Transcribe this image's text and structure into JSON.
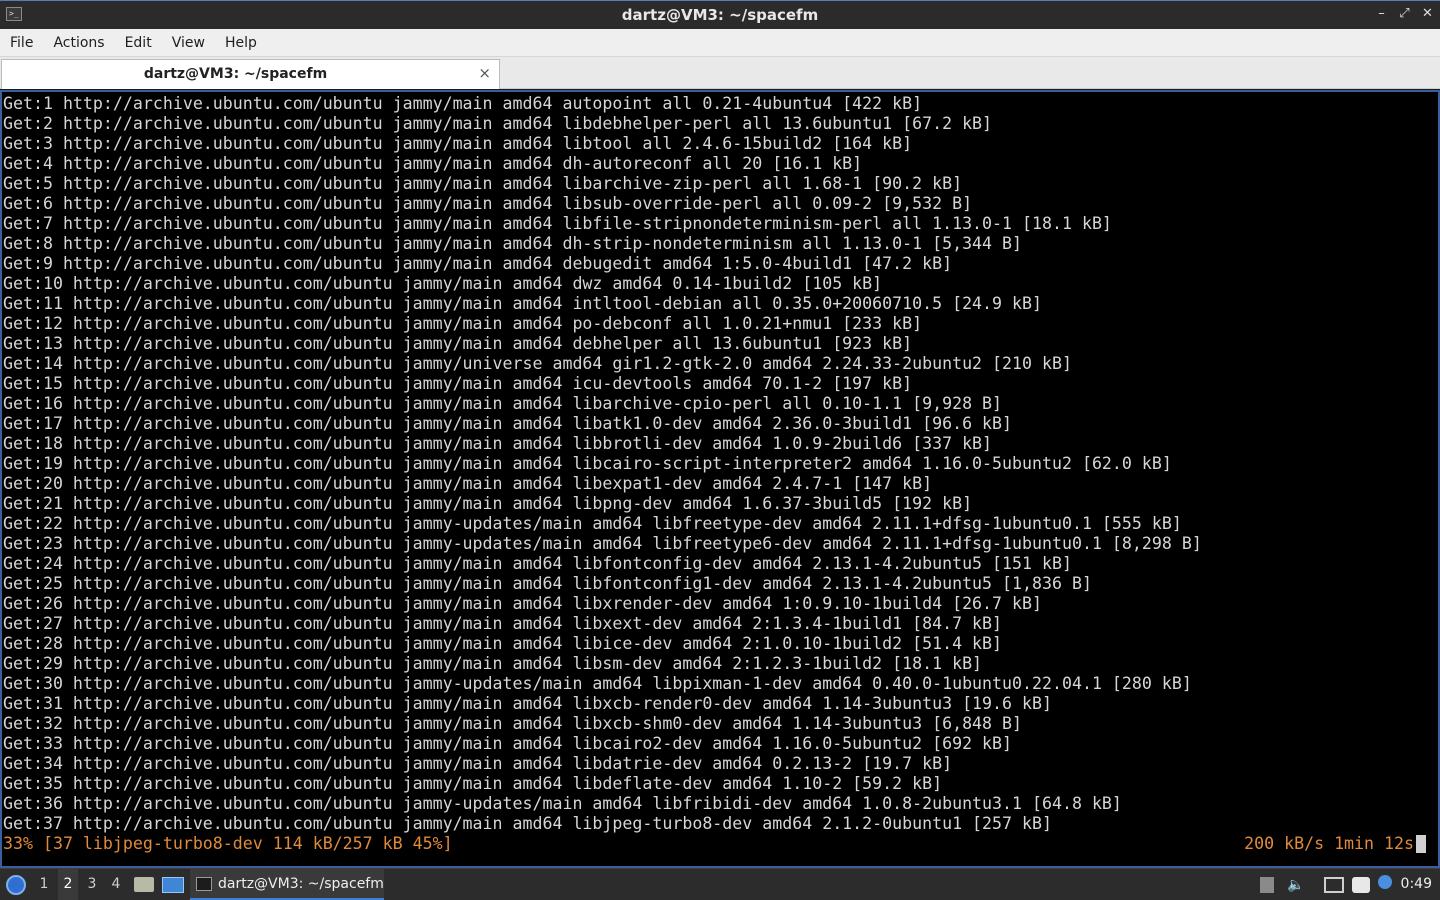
{
  "window": {
    "title": "dartz@VM3: ~/spacefm",
    "icon": "terminal-icon",
    "buttons": [
      "minimize",
      "maximize",
      "close"
    ]
  },
  "menu": [
    "File",
    "Actions",
    "Edit",
    "View",
    "Help"
  ],
  "tab": {
    "title": "dartz@VM3: ~/spacefm",
    "close_icon": "×"
  },
  "terminal": {
    "lines": [
      "Get:1 http://archive.ubuntu.com/ubuntu jammy/main amd64 autopoint all 0.21-4ubuntu4 [422 kB]",
      "Get:2 http://archive.ubuntu.com/ubuntu jammy/main amd64 libdebhelper-perl all 13.6ubuntu1 [67.2 kB]",
      "Get:3 http://archive.ubuntu.com/ubuntu jammy/main amd64 libtool all 2.4.6-15build2 [164 kB]",
      "Get:4 http://archive.ubuntu.com/ubuntu jammy/main amd64 dh-autoreconf all 20 [16.1 kB]",
      "Get:5 http://archive.ubuntu.com/ubuntu jammy/main amd64 libarchive-zip-perl all 1.68-1 [90.2 kB]",
      "Get:6 http://archive.ubuntu.com/ubuntu jammy/main amd64 libsub-override-perl all 0.09-2 [9,532 B]",
      "Get:7 http://archive.ubuntu.com/ubuntu jammy/main amd64 libfile-stripnondeterminism-perl all 1.13.0-1 [18.1 kB]",
      "Get:8 http://archive.ubuntu.com/ubuntu jammy/main amd64 dh-strip-nondeterminism all 1.13.0-1 [5,344 B]",
      "Get:9 http://archive.ubuntu.com/ubuntu jammy/main amd64 debugedit amd64 1:5.0-4build1 [47.2 kB]",
      "Get:10 http://archive.ubuntu.com/ubuntu jammy/main amd64 dwz amd64 0.14-1build2 [105 kB]",
      "Get:11 http://archive.ubuntu.com/ubuntu jammy/main amd64 intltool-debian all 0.35.0+20060710.5 [24.9 kB]",
      "Get:12 http://archive.ubuntu.com/ubuntu jammy/main amd64 po-debconf all 1.0.21+nmu1 [233 kB]",
      "Get:13 http://archive.ubuntu.com/ubuntu jammy/main amd64 debhelper all 13.6ubuntu1 [923 kB]",
      "Get:14 http://archive.ubuntu.com/ubuntu jammy/universe amd64 gir1.2-gtk-2.0 amd64 2.24.33-2ubuntu2 [210 kB]",
      "Get:15 http://archive.ubuntu.com/ubuntu jammy/main amd64 icu-devtools amd64 70.1-2 [197 kB]",
      "Get:16 http://archive.ubuntu.com/ubuntu jammy/main amd64 libarchive-cpio-perl all 0.10-1.1 [9,928 B]",
      "Get:17 http://archive.ubuntu.com/ubuntu jammy/main amd64 libatk1.0-dev amd64 2.36.0-3build1 [96.6 kB]",
      "Get:18 http://archive.ubuntu.com/ubuntu jammy/main amd64 libbrotli-dev amd64 1.0.9-2build6 [337 kB]",
      "Get:19 http://archive.ubuntu.com/ubuntu jammy/main amd64 libcairo-script-interpreter2 amd64 1.16.0-5ubuntu2 [62.0 kB]",
      "Get:20 http://archive.ubuntu.com/ubuntu jammy/main amd64 libexpat1-dev amd64 2.4.7-1 [147 kB]",
      "Get:21 http://archive.ubuntu.com/ubuntu jammy/main amd64 libpng-dev amd64 1.6.37-3build5 [192 kB]",
      "Get:22 http://archive.ubuntu.com/ubuntu jammy-updates/main amd64 libfreetype-dev amd64 2.11.1+dfsg-1ubuntu0.1 [555 kB]",
      "Get:23 http://archive.ubuntu.com/ubuntu jammy-updates/main amd64 libfreetype6-dev amd64 2.11.1+dfsg-1ubuntu0.1 [8,298 B]",
      "Get:24 http://archive.ubuntu.com/ubuntu jammy/main amd64 libfontconfig-dev amd64 2.13.1-4.2ubuntu5 [151 kB]",
      "Get:25 http://archive.ubuntu.com/ubuntu jammy/main amd64 libfontconfig1-dev amd64 2.13.1-4.2ubuntu5 [1,836 B]",
      "Get:26 http://archive.ubuntu.com/ubuntu jammy/main amd64 libxrender-dev amd64 1:0.9.10-1build4 [26.7 kB]",
      "Get:27 http://archive.ubuntu.com/ubuntu jammy/main amd64 libxext-dev amd64 2:1.3.4-1build1 [84.7 kB]",
      "Get:28 http://archive.ubuntu.com/ubuntu jammy/main amd64 libice-dev amd64 2:1.0.10-1build2 [51.4 kB]",
      "Get:29 http://archive.ubuntu.com/ubuntu jammy/main amd64 libsm-dev amd64 2:1.2.3-1build2 [18.1 kB]",
      "Get:30 http://archive.ubuntu.com/ubuntu jammy-updates/main amd64 libpixman-1-dev amd64 0.40.0-1ubuntu0.22.04.1 [280 kB]",
      "Get:31 http://archive.ubuntu.com/ubuntu jammy/main amd64 libxcb-render0-dev amd64 1.14-3ubuntu3 [19.6 kB]",
      "Get:32 http://archive.ubuntu.com/ubuntu jammy/main amd64 libxcb-shm0-dev amd64 1.14-3ubuntu3 [6,848 B]",
      "Get:33 http://archive.ubuntu.com/ubuntu jammy/main amd64 libcairo2-dev amd64 1.16.0-5ubuntu2 [692 kB]",
      "Get:34 http://archive.ubuntu.com/ubuntu jammy/main amd64 libdatrie-dev amd64 0.2.13-2 [19.7 kB]",
      "Get:35 http://archive.ubuntu.com/ubuntu jammy/main amd64 libdeflate-dev amd64 1.10-2 [59.2 kB]",
      "Get:36 http://archive.ubuntu.com/ubuntu jammy-updates/main amd64 libfribidi-dev amd64 1.0.8-2ubuntu3.1 [64.8 kB]",
      "Get:37 http://archive.ubuntu.com/ubuntu jammy/main amd64 libjpeg-turbo8-dev amd64 2.1.2-0ubuntu1 [257 kB]"
    ],
    "progress_left": "33% [37 libjpeg-turbo8-dev 114 kB/257 kB 45%]",
    "progress_right": "200 kB/s 1min 12s",
    "progress_color": "#e08a3c",
    "text_color": "#d6d6d6",
    "background": "#000000"
  },
  "taskbar": {
    "start_icon": "lubuntu-start-icon",
    "workspaces": [
      "1",
      "2",
      "3",
      "4"
    ],
    "active_workspace": "2",
    "task_label": "dartz@VM3: ~/spacefm",
    "tray_icons": [
      "removable-media-icon",
      "volume-icon",
      "network-icon",
      "clipboard-icon",
      "notification-icon"
    ],
    "clock": "0:49"
  }
}
